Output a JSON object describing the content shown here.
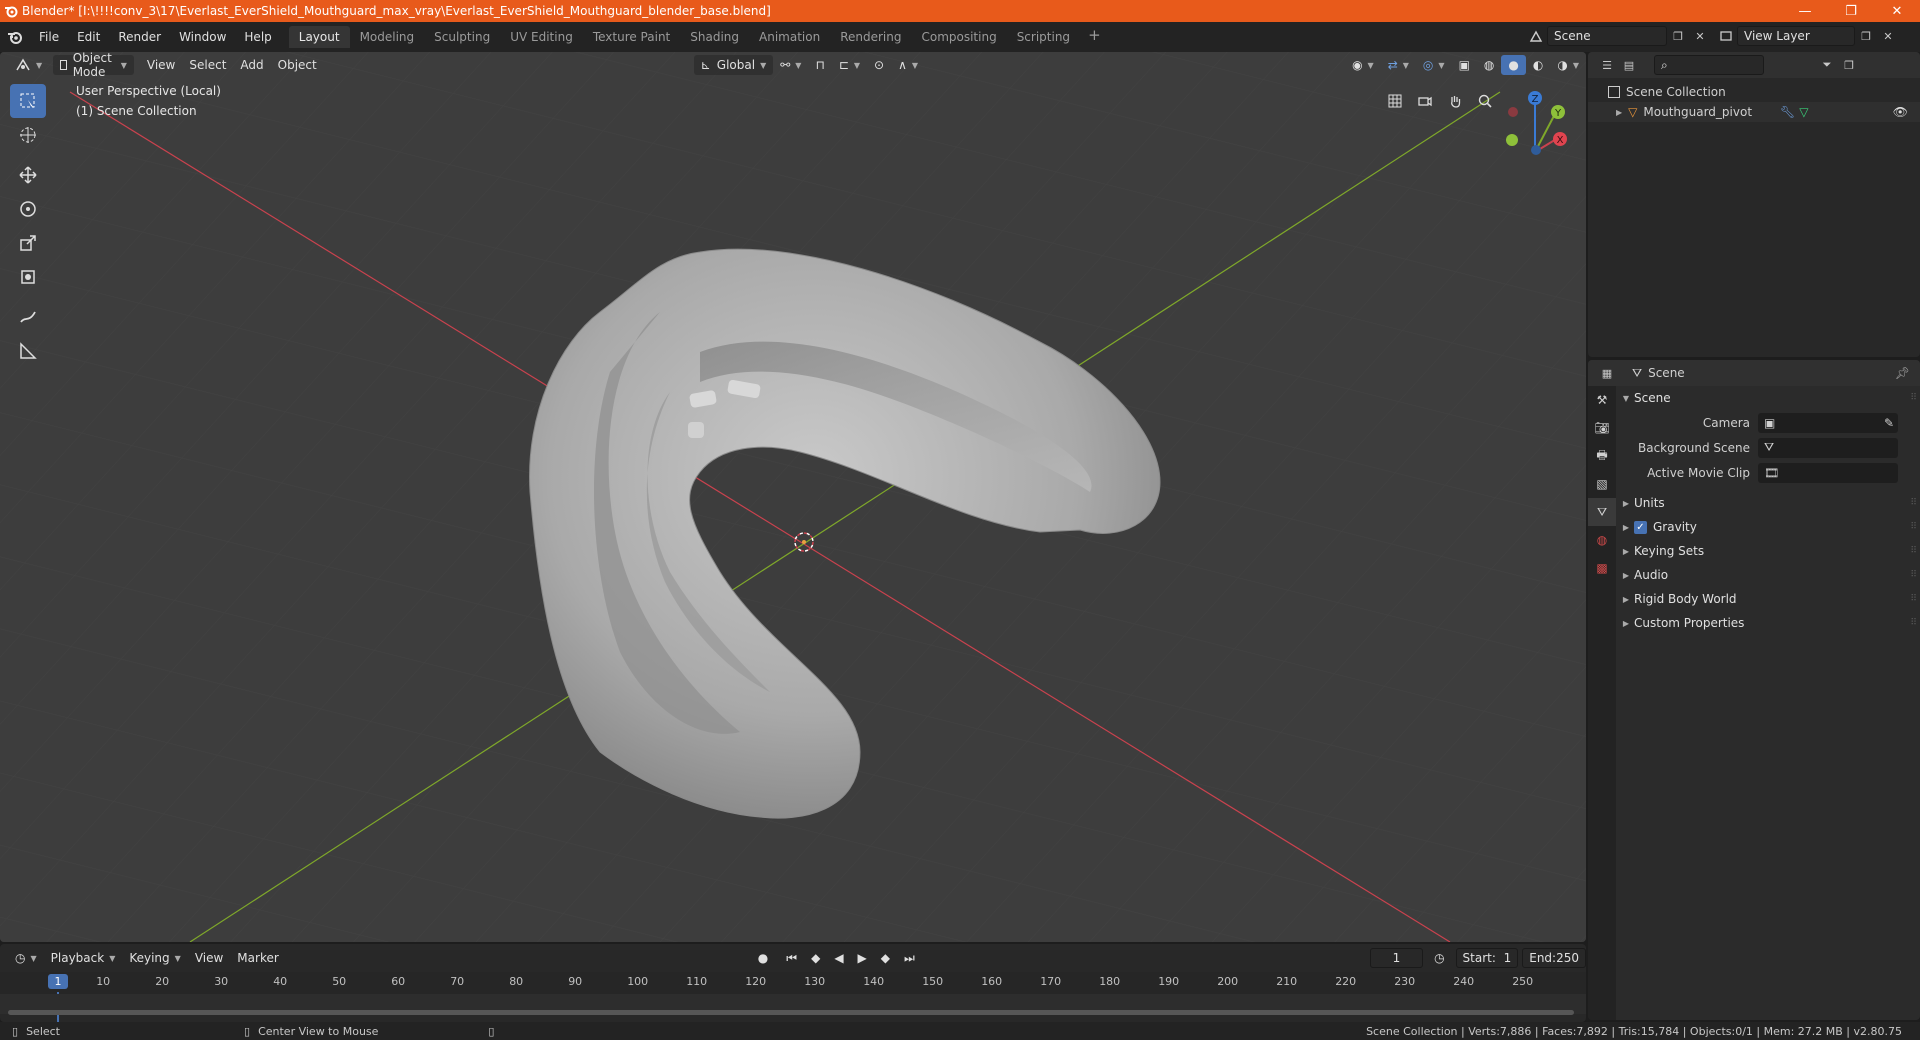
{
  "window": {
    "title": "Blender* [I:\\!!!!conv_3\\17\\Everlast_EverShield_Mouthguard_max_vray\\Everlast_EverShield_Mouthguard_blender_base.blend]",
    "minimize": "—",
    "restore": "❐",
    "close": "✕"
  },
  "menu": [
    "File",
    "Edit",
    "Render",
    "Window",
    "Help"
  ],
  "workspaces": [
    "Layout",
    "Modeling",
    "Sculpting",
    "UV Editing",
    "Texture Paint",
    "Shading",
    "Animation",
    "Rendering",
    "Compositing",
    "Scripting"
  ],
  "workspace_add": "+",
  "scene_selector": {
    "scene": "Scene",
    "view_layer": "View Layer"
  },
  "viewport": {
    "mode": "Object Mode",
    "menus": [
      "View",
      "Select",
      "Add",
      "Object"
    ],
    "orientation": "Global",
    "overlay_line1": "User Perspective (Local)",
    "overlay_line2": "(1) Scene Collection",
    "gizmo": {
      "z": "Z",
      "y": "Y",
      "x": "X"
    }
  },
  "outliner": {
    "root": "Scene Collection",
    "items": [
      {
        "label": "Mouthguard_pivot"
      }
    ]
  },
  "properties": {
    "context": "Scene",
    "panel_title": "Scene",
    "fields": [
      {
        "label": "Camera",
        "value": ""
      },
      {
        "label": "Background Scene",
        "value": ""
      },
      {
        "label": "Active Movie Clip",
        "value": ""
      }
    ],
    "sections": [
      {
        "label": "Units"
      },
      {
        "label": "Gravity",
        "checked": true
      },
      {
        "label": "Keying Sets"
      },
      {
        "label": "Audio"
      },
      {
        "label": "Rigid Body World"
      },
      {
        "label": "Custom Properties"
      }
    ]
  },
  "timeline": {
    "menus": [
      "Playback",
      "Keying",
      "View",
      "Marker"
    ],
    "current_frame": "1",
    "start_label": "Start:",
    "start": "1",
    "end_label": "End:",
    "end": "250",
    "ruler": [
      "1",
      "10",
      "20",
      "30",
      "40",
      "50",
      "60",
      "70",
      "80",
      "90",
      "100",
      "110",
      "120",
      "130",
      "140",
      "150",
      "160",
      "170",
      "180",
      "190",
      "200",
      "210",
      "220",
      "230",
      "240",
      "250"
    ]
  },
  "statusbar": {
    "select": "Select",
    "center": "Center View to Mouse",
    "stats": "Scene Collection | Verts:7,886 | Faces:7,892 | Tris:15,784 | Objects:0/1 | Mem: 27.2 MB | v2.80.75"
  },
  "colors": {
    "accent": "#4772b3",
    "titlebar": "#e85a1b",
    "x_axis": "#c9424e",
    "y_axis": "#7fa82a",
    "z_axis": "#3a7bd5"
  }
}
